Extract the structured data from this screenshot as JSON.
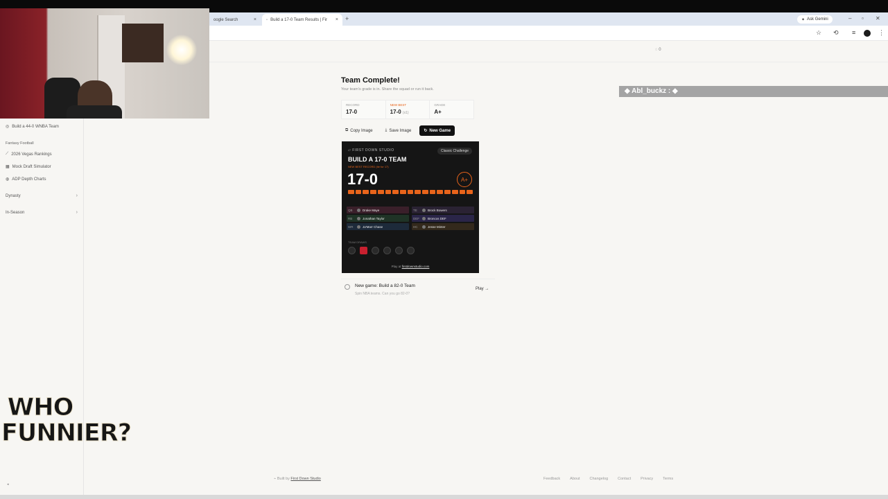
{
  "browser": {
    "tabs": [
      {
        "label": "oogle Search",
        "active": false
      },
      {
        "label": "Build a 17-0 Team Results | Fir",
        "active": true
      }
    ],
    "new_tab": "+",
    "ask_gemini": "Ask Gemini",
    "close_symbol": "×"
  },
  "header": {
    "notification_count": "0"
  },
  "sidebar": {
    "items": [
      {
        "label": "Build a 44-0 WNBA Team",
        "icon": "basketball-icon"
      }
    ],
    "section_title": "Fantasy Football",
    "football_items": [
      {
        "label": "2026 Vegas Rankings",
        "icon": "chart-icon"
      },
      {
        "label": "Mock Draft Simulator",
        "icon": "grid-icon"
      },
      {
        "label": "ADP Depth Charts",
        "icon": "globe-icon"
      }
    ],
    "groups": [
      {
        "label": "Dynasty"
      },
      {
        "label": "In-Season"
      }
    ]
  },
  "overlay": {
    "who_funnier": "WHO FUNNIER?",
    "chat_user": "Abl_buckz :"
  },
  "main": {
    "title": "Team Complete!",
    "subtitle": "Your team's grade is in. Share the squad or run it back.",
    "stats": [
      {
        "label": "Record",
        "value": "17-0",
        "suffix": "",
        "highlight": false
      },
      {
        "label": "New Best",
        "value": "17-0",
        "suffix": "(x1)",
        "highlight": true
      },
      {
        "label": "Grade",
        "value": "A+",
        "suffix": "",
        "highlight": false
      }
    ],
    "buttons": {
      "copy": "Copy Image",
      "save": "Save Image",
      "new_game": "New Game"
    }
  },
  "card": {
    "studio": "FIRST DOWN STUDIO",
    "pill": "Classic Challenge",
    "heading": "BUILD A 17-0 TEAM",
    "best_line": "NEW BEST RECORD (tie for 17)",
    "record": "17-0",
    "grade": "A+",
    "roster": [
      {
        "pos": "QB",
        "name": "Drake Maye",
        "right_pos": "TE",
        "right_name": "Brock Bowers"
      },
      {
        "pos": "RB",
        "name": "Jonathan Taylor",
        "right_pos": "DEF",
        "right_name": "Broncos DEF"
      },
      {
        "pos": "WR",
        "name": "Ja'Marr Chase",
        "right_pos": "HC",
        "right_name": "Jesse Minter"
      }
    ],
    "draws_label": "TEAM DRAWS",
    "play_prefix": "Play at",
    "play_link": "firstdownstudio.com"
  },
  "new_game": {
    "title": "New game: Build a 82-0 Team",
    "subtitle": "Spin NBA teams. Can you go 82-0?",
    "play": "Play →"
  },
  "footer": {
    "built_prefix": "Built by",
    "built_link": "First Down Studio",
    "links": [
      "Feedback",
      "About",
      "Changelog",
      "Contact",
      "Privacy",
      "Terms"
    ]
  },
  "colors": {
    "accent": "#e8641b",
    "card_bg": "#151515",
    "page_bg": "#f7f6f3"
  }
}
